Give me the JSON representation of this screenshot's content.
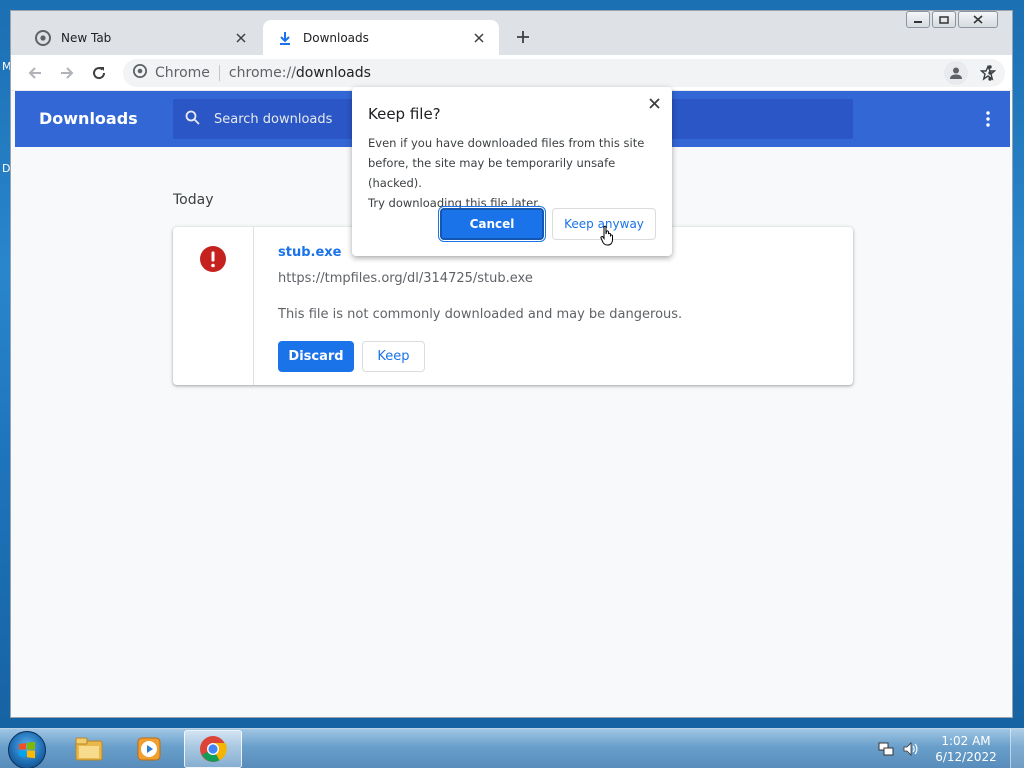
{
  "desktop": {
    "edge_text_top": "M",
    "edge_text_mid": "D"
  },
  "browser": {
    "tabs": [
      {
        "title": "New Tab",
        "icon": "chrome-icon",
        "active": false
      },
      {
        "title": "Downloads",
        "icon": "download-arrow-icon",
        "active": true
      }
    ],
    "omnibox": {
      "site_label": "Chrome",
      "url_scheme": "chrome://",
      "url_host": "downloads"
    }
  },
  "downloads_page": {
    "header_title": "Downloads",
    "search_placeholder": "Search downloads",
    "section_label": "Today",
    "item": {
      "file_name": "stub.exe",
      "url": "https://tmpfiles.org/dl/314725/stub.exe",
      "warning": "This file is not commonly downloaded and may be dangerous.",
      "discard_label": "Discard",
      "keep_label": "Keep"
    }
  },
  "dialog": {
    "title": "Keep file?",
    "body_line1": "Even if you have downloaded files from this site",
    "body_line2": "before, the site may be temporarily unsafe (hacked).",
    "body_line3": "Try downloading this file later.",
    "cancel_label": "Cancel",
    "keep_anyway_label": "Keep anyway"
  },
  "taskbar": {
    "clock_time": "1:02 AM",
    "clock_date": "6/12/2022",
    "pinned": [
      "file-explorer-icon",
      "media-player-icon",
      "chrome-icon"
    ]
  },
  "colors": {
    "accent": "#1a73e8",
    "header_blue": "#3367d6",
    "danger_red": "#c5221f"
  }
}
